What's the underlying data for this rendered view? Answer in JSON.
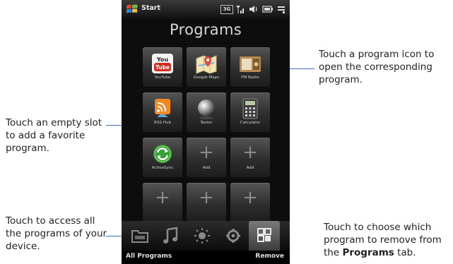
{
  "status_bar": {
    "start_label": "Start",
    "icons": [
      "network-3g-icon",
      "signal-icon",
      "speaker-icon",
      "battery-icon",
      "connectivity-icon"
    ]
  },
  "screen": {
    "title": "Programs"
  },
  "tiles": [
    {
      "label": "YouTube",
      "icon": "youtube-icon",
      "empty": false
    },
    {
      "label": "Google Maps",
      "icon": "google-maps-icon",
      "empty": false
    },
    {
      "label": "FM Radio",
      "icon": "fm-radio-icon",
      "empty": false
    },
    {
      "label": "RSS Hub",
      "icon": "rss-hub-icon",
      "empty": false
    },
    {
      "label": "Teeter",
      "icon": "teeter-icon",
      "empty": false
    },
    {
      "label": "Calculator",
      "icon": "calculator-icon",
      "empty": false
    },
    {
      "label": "ActiveSync",
      "icon": "activesync-icon",
      "empty": false
    },
    {
      "label": "Add",
      "icon": "plus-icon",
      "empty": true
    },
    {
      "label": "Add",
      "icon": "plus-icon",
      "empty": true
    },
    {
      "label": "",
      "icon": "plus-icon",
      "empty": true
    },
    {
      "label": "",
      "icon": "plus-icon",
      "empty": true
    },
    {
      "label": "",
      "icon": "plus-icon",
      "empty": true
    }
  ],
  "tab_bar": {
    "tabs": [
      "folder-icon",
      "music-icon",
      "weather-icon",
      "settings-icon",
      "programs-grid-icon"
    ],
    "active": "programs-grid-icon"
  },
  "soft_keys": {
    "left": "All Programs",
    "right": "Remove"
  },
  "callouts": {
    "program_icon": "Touch a program icon to open the corresponding program.",
    "empty_slot": "Touch an empty slot to add a favorite program.",
    "all_programs": "Touch to access all the programs of your device.",
    "remove_prefix": "Touch to choose which program to remove from the ",
    "remove_bold": "Programs",
    "remove_suffix": " tab."
  },
  "colors": {
    "callout_line": "#3a6fb5",
    "youtube_red": "#d42b1e",
    "rss_orange": "#f08a24",
    "activesync_green": "#37a03a"
  }
}
